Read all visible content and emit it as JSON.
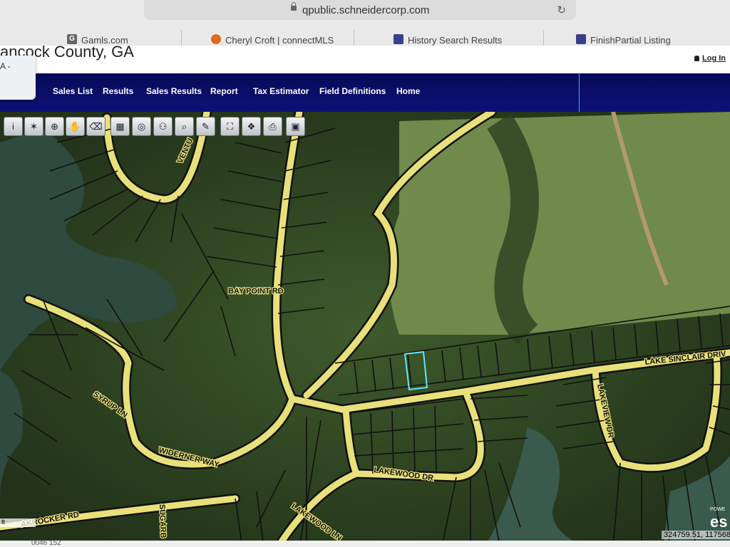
{
  "browser": {
    "url": "qpublic.schneidercorp.com",
    "tabs": [
      {
        "label": "Gamls.com",
        "icon": "gamls-icon",
        "fav": "G"
      },
      {
        "label": "Cheryl Croft | connectMLS",
        "icon": "house-icon",
        "fav": ""
      },
      {
        "label": "History Search Results",
        "icon": "mls-icon",
        "fav": ""
      },
      {
        "label": "FinishPartial Listing",
        "icon": "mls-icon",
        "fav": ""
      }
    ]
  },
  "site": {
    "county_title": "ancock County, GA",
    "login": "Log In",
    "overlay_text": "A -"
  },
  "nav": {
    "items": [
      "Sales List",
      "Results",
      "Sales Results",
      "Report",
      "Tax Estimator",
      "Field Definitions",
      "Home"
    ]
  },
  "toolbar": {
    "tools": [
      {
        "name": "info-icon",
        "glyph": "i"
      },
      {
        "name": "select-icon",
        "glyph": "✶"
      },
      {
        "name": "zoom-in-icon",
        "glyph": "⊕"
      },
      {
        "name": "pan-icon",
        "glyph": "✋"
      },
      {
        "name": "eraser-icon",
        "glyph": "⌫"
      },
      {
        "name": "buffer-icon",
        "glyph": "▦"
      },
      {
        "name": "layers-icon",
        "glyph": "◎"
      },
      {
        "name": "network-icon",
        "glyph": "⚇"
      },
      {
        "name": "search-icon",
        "glyph": "⌕"
      },
      {
        "name": "draw-icon",
        "glyph": "✎"
      },
      {
        "name": "full-extent-icon",
        "glyph": "⛶"
      },
      {
        "name": "identify-icon",
        "glyph": "❖"
      },
      {
        "name": "print-icon",
        "glyph": "⎙"
      },
      {
        "name": "save-icon",
        "glyph": "▣"
      }
    ]
  },
  "map": {
    "road_labels": [
      "BAY POINT RD",
      "LAKE SINCLAIR DRIV",
      "LAKEVIEW DR",
      "SYRUP LN",
      "WIDERNER WAY",
      "LAKEWOOD DR",
      "LAKEWOOD LN",
      "SUGARB",
      "AKROCKER RD",
      "VENTU"
    ],
    "scale_text": "ft",
    "coordinates": "324759.51, 1175686",
    "attribution_small": "POWE",
    "attribution": "es",
    "bottom_text": "0046 152"
  },
  "colors": {
    "nav_bg": "#0a0f6e",
    "road": "#e8e07a",
    "parcel_line": "#111111",
    "selected_parcel": "#5fe8f5"
  }
}
